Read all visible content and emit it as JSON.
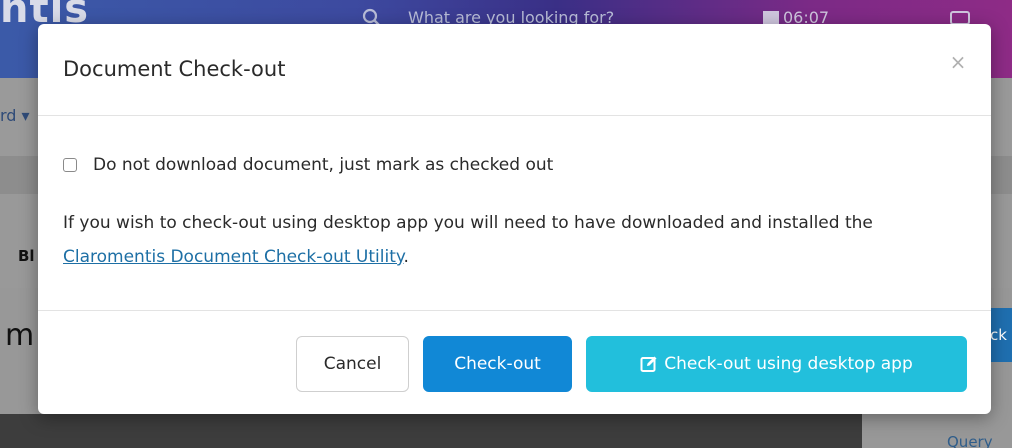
{
  "background": {
    "logo_text": "ntis",
    "search_placeholder": "What are you looking for?",
    "time": "06:07",
    "nav_text": "rd ▾",
    "panel_text": "Bl",
    "content_heading": "m",
    "right_button_text": "ck",
    "query_text": "Query"
  },
  "modal": {
    "title": "Document Check-out",
    "close_label": "×",
    "checkbox_label": "Do not download document, just mark as checked out",
    "checkbox_checked": false,
    "info_text_before": "If you wish to check-out using desktop app you will need to have downloaded and installed the ",
    "info_link": "Claromentis Document Check-out Utility",
    "info_text_after": "."
  },
  "buttons": {
    "cancel": "Cancel",
    "checkout": "Check-out",
    "desktop": "Check-out using desktop app"
  },
  "colors": {
    "primary": "#1188d6",
    "info": "#22bfdc",
    "link": "#1d6fa5"
  },
  "icons": {
    "search": "search-icon",
    "calendar": "calendar-icon",
    "user": "user-icon",
    "close": "close-icon",
    "edit": "edit-icon"
  }
}
